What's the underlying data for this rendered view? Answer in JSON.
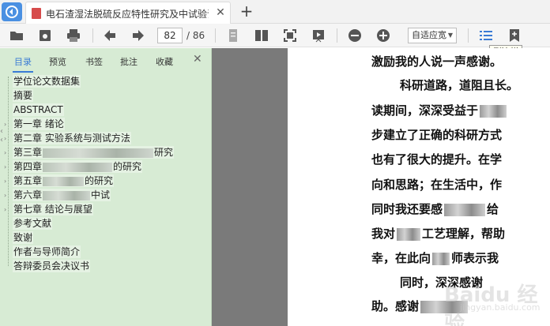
{
  "tabbar": {
    "tab_title": "电石渣湿法脱硫反应特性研究及中试验证_...",
    "close_glyph": "✕",
    "new_tab_glyph": "+"
  },
  "toolbar": {
    "page_current": "82",
    "page_total": "/ 86",
    "zoom_mode": "自适应宽",
    "icons": [
      "folder-open-icon",
      "save-icon",
      "print-icon",
      "prev-page-icon",
      "next-page-icon",
      "single-page-icon",
      "dual-page-icon",
      "fit-page-icon",
      "play-icon",
      "zoom-out-icon",
      "zoom-in-icon",
      "sidebar-toggle-icon",
      "bookmark-icon"
    ]
  },
  "tooltip": {
    "text": "侧边栏"
  },
  "sidebar": {
    "tabs": [
      "目录",
      "预览",
      "书签",
      "批注",
      "收藏"
    ],
    "active_tab": "目录",
    "close_glyph": "✕",
    "outline": [
      {
        "text": "学位论文数据集"
      },
      {
        "text": "摘要"
      },
      {
        "text": "ABSTRACT"
      },
      {
        "text": "第一章 绪论"
      },
      {
        "text": "第二章 实验系统与测试方法"
      },
      {
        "text": "第三章",
        "tail": "研究"
      },
      {
        "text": "第四章",
        "tail": "的研究"
      },
      {
        "text": "第五章",
        "tail": "的研究"
      },
      {
        "text": "第六章",
        "tail": "中试"
      },
      {
        "text": "第七章 结论与展望"
      },
      {
        "text": "参考文献"
      },
      {
        "text": "致谢"
      },
      {
        "text": "作者与导师简介"
      },
      {
        "text": "答辩委员会决议书"
      }
    ]
  },
  "document": {
    "lines": [
      {
        "a": "激励我的人说一声感谢。"
      },
      {
        "a": "科研道路，道阻且长。"
      },
      {
        "a": "读期间，深深受益于"
      },
      {
        "a": "步建立了正确的科研方式"
      },
      {
        "a": "也有了很大的提升。在学"
      },
      {
        "a": "向和思路；在生活中，作"
      },
      {
        "a": "同时我还要感",
        "b": "给"
      },
      {
        "a": "我对",
        "b": "工艺理解，帮助"
      },
      {
        "a": "幸，在此向",
        "b": "师表示我"
      },
      {
        "a": "同时，深深感谢"
      },
      {
        "a": "助。感谢"
      }
    ]
  },
  "watermark": {
    "main": "Baidu 经验",
    "sub": "jingyan.baidu.com"
  },
  "colors": {
    "accent": "#3a7bd5",
    "sidebar_bg": "#d7ebd4",
    "gutter": "#7a7a7a"
  }
}
